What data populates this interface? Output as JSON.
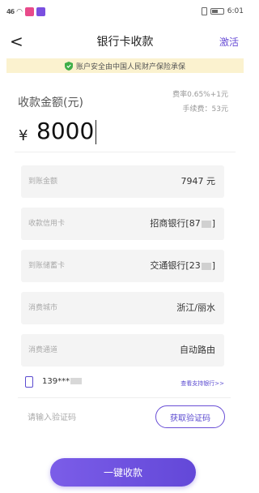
{
  "status_bar": {
    "signal_text": "46",
    "time": "6:01",
    "app_icon_colors": [
      "#e84a8a",
      "#7a4fe0"
    ]
  },
  "nav": {
    "back_glyph": "<",
    "title": "银行卡收款",
    "action_label": "激活"
  },
  "banner": {
    "text": "账户安全由中国人民财产保险承保",
    "shield_color": "#3fae49"
  },
  "amount": {
    "label": "收款金额(元)",
    "fee_rate": "费率0.65%+1元",
    "fee_amount": "手续费：53元",
    "currency_symbol": "¥",
    "value": "8000"
  },
  "rows": [
    {
      "label": "到账金额",
      "value": "7947 元"
    },
    {
      "label": "收款信用卡",
      "value": "招商银行[87",
      "value_suffix": "]"
    },
    {
      "label": "到账储蓄卡",
      "value": "交通银行[23",
      "value_suffix": "]"
    },
    {
      "label": "消费城市",
      "value": "浙江/丽水"
    },
    {
      "label": "消费通道",
      "value": "自动路由"
    }
  ],
  "phone": {
    "number": "139***",
    "support_link": "查看支持银行>>"
  },
  "verify": {
    "placeholder": "请输入验证码",
    "button_label": "获取验证码"
  },
  "submit": {
    "label": "一键收款"
  },
  "colors": {
    "accent": "#6a4fd6",
    "banner_bg": "#fbf2cf",
    "row_bg": "#f4f4f4"
  }
}
